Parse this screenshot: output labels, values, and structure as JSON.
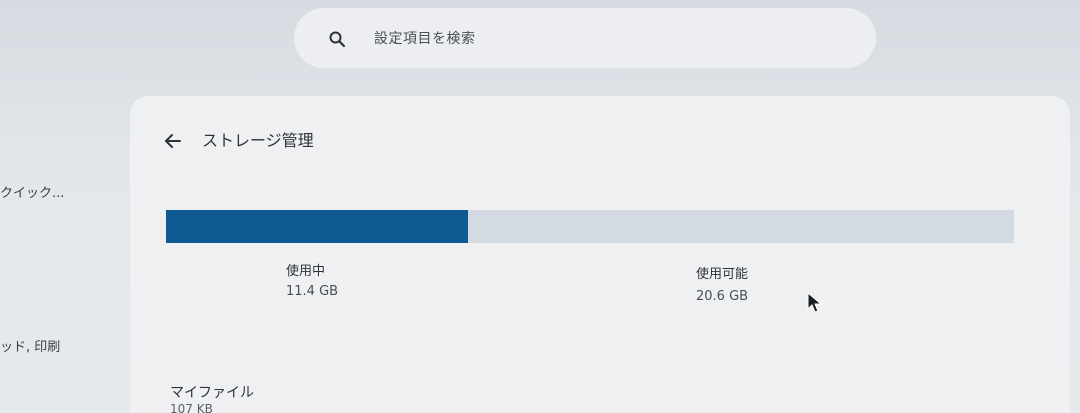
{
  "search": {
    "placeholder": "設定項目を検索"
  },
  "sidebar": {
    "items": [
      {
        "label": "クイック..."
      },
      {
        "label": "ッド, 印刷"
      }
    ]
  },
  "header": {
    "title": "ストレージ管理"
  },
  "storage": {
    "used_fraction": 0.356,
    "used_label": "使用中",
    "used_value": "11.4 GB",
    "available_label": "使用可能",
    "available_value": "20.6 GB"
  },
  "files": {
    "my_files_label": "マイファイル",
    "my_files_size": "107 KB"
  },
  "colors": {
    "bar_fill": "#0f5a92",
    "bar_track": "#d4dae2"
  },
  "icons": {
    "search": "search-icon",
    "back": "arrow-left-icon",
    "cursor": "mouse-pointer-icon"
  }
}
